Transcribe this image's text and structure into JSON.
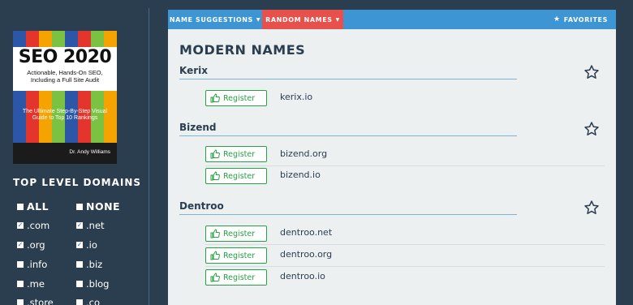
{
  "book": {
    "title": "SEO 2020",
    "subtitle": "Actionable, Hands-On SEO, Including a Full Site Audit",
    "tagline": "The Ultimate Step-By-Step Visual Guide to Top 10 Rankings",
    "author": "Dr. Andy Williams",
    "stripe_colors": [
      "#2c57a8",
      "#e3352c",
      "#f5a300",
      "#7cc242",
      "#2c57a8",
      "#e3352c",
      "#7cc242",
      "#f5a300"
    ]
  },
  "sidebar": {
    "heading": "TOP LEVEL DOMAINS",
    "all_label": "ALL",
    "none_label": "NONE",
    "tlds": [
      {
        "label": ".com",
        "checked": true
      },
      {
        "label": ".net",
        "checked": true
      },
      {
        "label": ".org",
        "checked": true
      },
      {
        "label": ".io",
        "checked": true
      },
      {
        "label": ".info",
        "checked": false
      },
      {
        "label": ".biz",
        "checked": false
      },
      {
        "label": ".me",
        "checked": false
      },
      {
        "label": ".blog",
        "checked": false
      },
      {
        "label": ".store",
        "checked": false
      },
      {
        "label": ".co",
        "checked": false
      }
    ]
  },
  "nav": {
    "suggestions": "NAME SUGGESTIONS",
    "random": "RANDOM NAMES",
    "favorites": "FAVORITES",
    "favorites_icon": "star-icon",
    "caret_icon": "caret-down-icon"
  },
  "main": {
    "title": "MODERN NAMES",
    "register_label": "Register",
    "groups": [
      {
        "name": "Kerix",
        "domains": [
          "kerix.io"
        ]
      },
      {
        "name": "Bizend",
        "domains": [
          "bizend.org",
          "bizend.io"
        ]
      },
      {
        "name": "Dentroo",
        "domains": [
          "dentroo.net",
          "dentroo.org",
          "dentroo.io"
        ]
      }
    ]
  },
  "colors": {
    "background": "#2b3e50",
    "nav_blue": "#3d95d3",
    "active_tab": "#e7504b",
    "panel": "#ecf0f1",
    "register_green": "#25a244"
  }
}
